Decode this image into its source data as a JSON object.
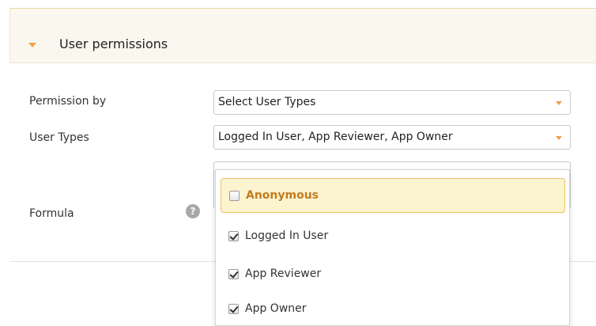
{
  "section": {
    "title": "User permissions"
  },
  "form": {
    "permission_by": {
      "label": "Permission by",
      "value": "Select User Types"
    },
    "user_types": {
      "label": "User Types",
      "value": "Logged In User, App Reviewer, App Owner"
    },
    "formula": {
      "label": "Formula",
      "help_icon": "?"
    }
  },
  "dropdown": {
    "options": [
      {
        "label": "Anonymous",
        "checked": false,
        "highlighted": true
      },
      {
        "label": "Logged In User",
        "checked": true,
        "highlighted": false
      },
      {
        "label": "App Reviewer",
        "checked": true,
        "highlighted": false
      },
      {
        "label": "App Owner",
        "checked": true,
        "highlighted": false
      }
    ]
  },
  "colors": {
    "accent": "#f0a04b",
    "highlight_bg": "#fcf4cf",
    "highlight_text": "#c37b1f",
    "header_bg": "#faf7ef"
  },
  "icons": {
    "section_caret": "caret-down-icon",
    "select_arrow": "chevron-down-icon",
    "help": "help-icon"
  }
}
